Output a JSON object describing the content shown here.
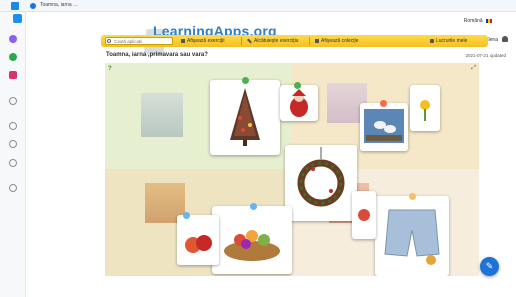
{
  "browser": {
    "tab_title": "Toamna, iarna ...",
    "accent": "#1a73e8"
  },
  "header": {
    "language": "Română",
    "user_greeting": "Salut conț Ramona Elena",
    "logo_text": "LearningApps.org"
  },
  "navbar": {
    "search_placeholder": "Caută aplicații",
    "items": [
      {
        "label": "Afişează exerciţii",
        "icon": "grid-icon"
      },
      {
        "label": "Alcătuiește exercițiu",
        "icon": "pencil-icon"
      },
      {
        "label": "Afişează colecţie",
        "icon": "collection-icon"
      },
      {
        "label": "Lucrurile mele",
        "icon": "folder-icon"
      }
    ]
  },
  "app": {
    "title": "Toamna, iarna ,primavara sau vara?",
    "date": "2021-07-21 updated"
  },
  "colors": {
    "navbar": "#f4c020",
    "winter": "#e6efcf",
    "spring": "#f4e8c8",
    "autumn": "#efe4c2",
    "summer": "#f6eddc",
    "fab": "#1e73d8"
  }
}
